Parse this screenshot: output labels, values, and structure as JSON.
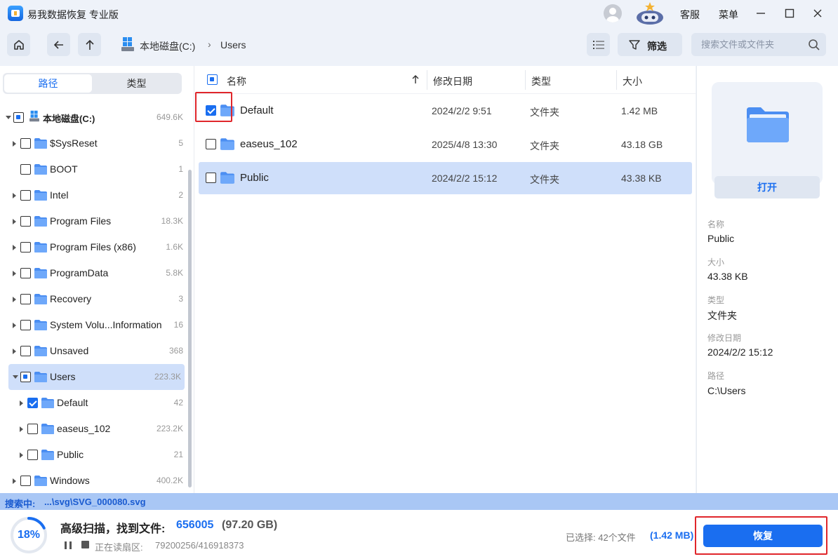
{
  "app": {
    "title": "易我数据恢复 专业版"
  },
  "titlebar": {
    "service": "客服",
    "menu": "菜单"
  },
  "breadcrumb": {
    "drive": "本地磁盘(C:)",
    "folder": "Users"
  },
  "toolbar": {
    "filter_label": "筛选",
    "search_placeholder": "搜索文件或文件夹"
  },
  "left": {
    "tabs": [
      "路径",
      "类型"
    ],
    "active_tab": "路径",
    "tree": [
      {
        "label": "本地磁盘(C:)",
        "count": "649.6K",
        "state": "partial",
        "expanded": true
      },
      {
        "label": "$SysReset",
        "count": "5",
        "state": "unchecked"
      },
      {
        "label": "BOOT",
        "count": "1",
        "state": "unchecked"
      },
      {
        "label": "Intel",
        "count": "2",
        "state": "unchecked"
      },
      {
        "label": "Program Files",
        "count": "18.3K",
        "state": "unchecked"
      },
      {
        "label": "Program Files (x86)",
        "count": "1.6K",
        "state": "unchecked"
      },
      {
        "label": "ProgramData",
        "count": "5.8K",
        "state": "unchecked"
      },
      {
        "label": "Recovery",
        "count": "3",
        "state": "unchecked"
      },
      {
        "label": "System Volu...Information",
        "count": "16",
        "state": "unchecked"
      },
      {
        "label": "Unsaved",
        "count": "368",
        "state": "unchecked"
      },
      {
        "label": "Users",
        "count": "223.3K",
        "state": "partial",
        "expanded": true,
        "selected": true
      },
      {
        "label": "Default",
        "count": "42",
        "state": "checked"
      },
      {
        "label": "easeus_102",
        "count": "223.2K",
        "state": "unchecked"
      },
      {
        "label": "Public",
        "count": "21",
        "state": "unchecked"
      },
      {
        "label": "Windows",
        "count": "400.2K",
        "state": "unchecked"
      }
    ]
  },
  "list": {
    "columns": {
      "name": "名称",
      "date": "修改日期",
      "type": "类型",
      "size": "大小"
    },
    "rows": [
      {
        "name": "Default",
        "date": "2024/2/2 9:51",
        "type": "文件夹",
        "size": "1.42 MB",
        "checked": true
      },
      {
        "name": "easeus_102",
        "date": "2025/4/8 13:30",
        "type": "文件夹",
        "size": "43.18 GB",
        "checked": false
      },
      {
        "name": "Public",
        "date": "2024/2/2 15:12",
        "type": "文件夹",
        "size": "43.38 KB",
        "checked": false,
        "selected": true
      }
    ]
  },
  "detail": {
    "open_label": "打开",
    "name_label": "名称",
    "name": "Public",
    "size_label": "大小",
    "size": "43.38 KB",
    "type_label": "类型",
    "type": "文件夹",
    "date_label": "修改日期",
    "date": "2024/2/2 15:12",
    "path_label": "路径",
    "path": "C:\\Users"
  },
  "status": {
    "label": "搜索中:",
    "path": "...\\svg\\SVG_000080.svg"
  },
  "bottom": {
    "progress_text": "18%",
    "progress": 0.18,
    "scan_title": "高级扫描，找到文件:",
    "scan_count": "656005",
    "scan_size": "(97.20 GB)",
    "read_label": "正在读扇区:",
    "read_value": "79200256/416918373",
    "selected_label": "已选择: 42个文件",
    "selected_size": "(1.42 MB)",
    "recover_label": "恢复"
  },
  "colors": {
    "accent": "#1a6ef0",
    "highlight": "#e0262b",
    "selected_row": "#cfdffa"
  }
}
